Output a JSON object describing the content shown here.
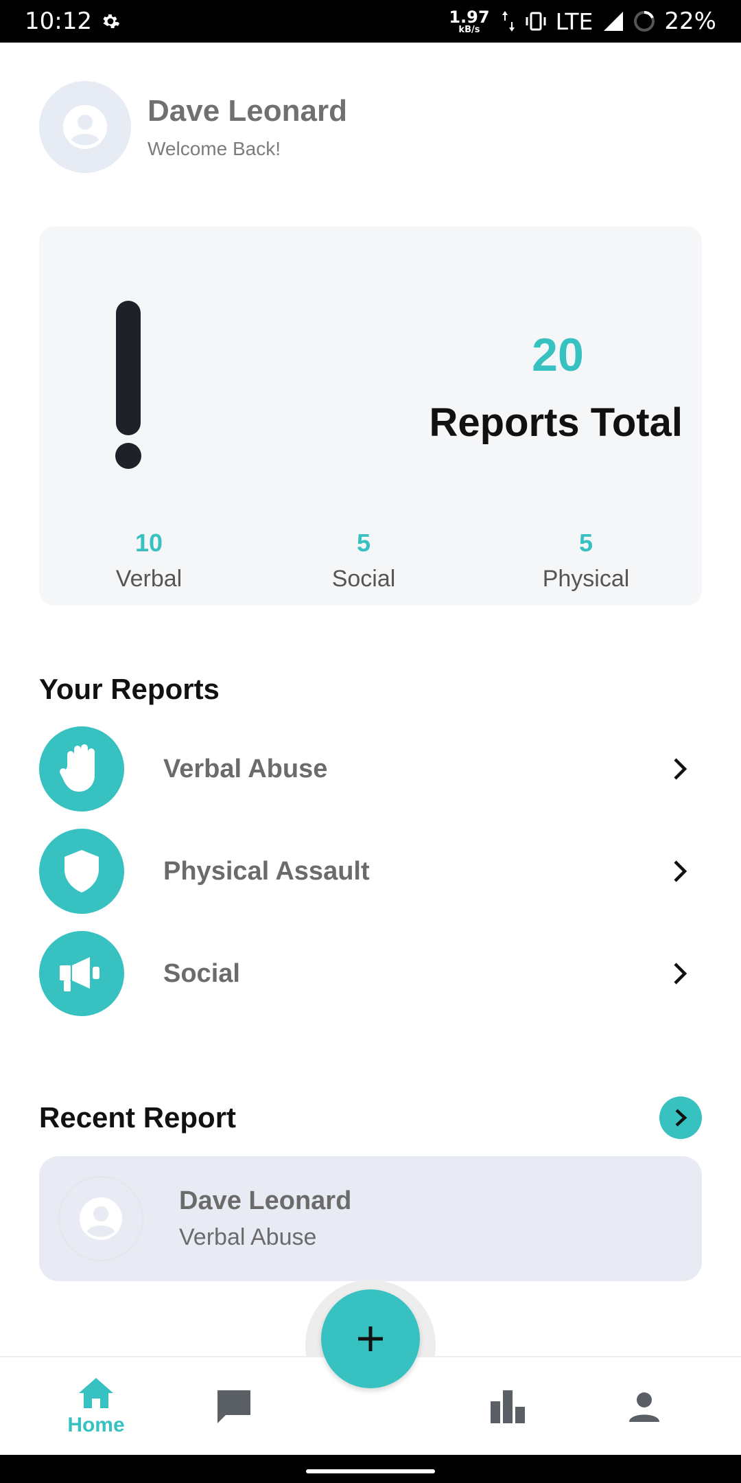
{
  "status_bar": {
    "time": "10:12",
    "speed_value": "1.97",
    "speed_unit": "kB/s",
    "network": "LTE",
    "battery": "22%"
  },
  "profile": {
    "name": "Dave Leonard",
    "subtitle": "Welcome Back!"
  },
  "summary": {
    "total": "20",
    "total_label": "Reports Total",
    "stats": [
      {
        "value": "10",
        "label": "Verbal"
      },
      {
        "value": "5",
        "label": "Social"
      },
      {
        "value": "5",
        "label": "Physical"
      }
    ]
  },
  "your_reports": {
    "title": "Your Reports",
    "items": [
      {
        "label": "Verbal Abuse",
        "icon": "hand-icon"
      },
      {
        "label": "Physical Assault",
        "icon": "shield-icon"
      },
      {
        "label": "Social",
        "icon": "megaphone-icon"
      }
    ]
  },
  "recent_report": {
    "title": "Recent Report",
    "name": "Dave Leonard",
    "type": "Verbal Abuse"
  },
  "bottom_nav": {
    "items": [
      {
        "label": "Home",
        "icon": "home-icon"
      },
      {
        "label": "",
        "icon": "chat-icon"
      },
      {
        "label": "",
        "icon": "bar-chart-icon"
      },
      {
        "label": "",
        "icon": "person-icon"
      }
    ],
    "fab_icon": "plus-icon"
  },
  "colors": {
    "accent": "#37c1c1",
    "card_bg": "#f5f6f8",
    "recent_card_bg": "#e8ebf3"
  }
}
